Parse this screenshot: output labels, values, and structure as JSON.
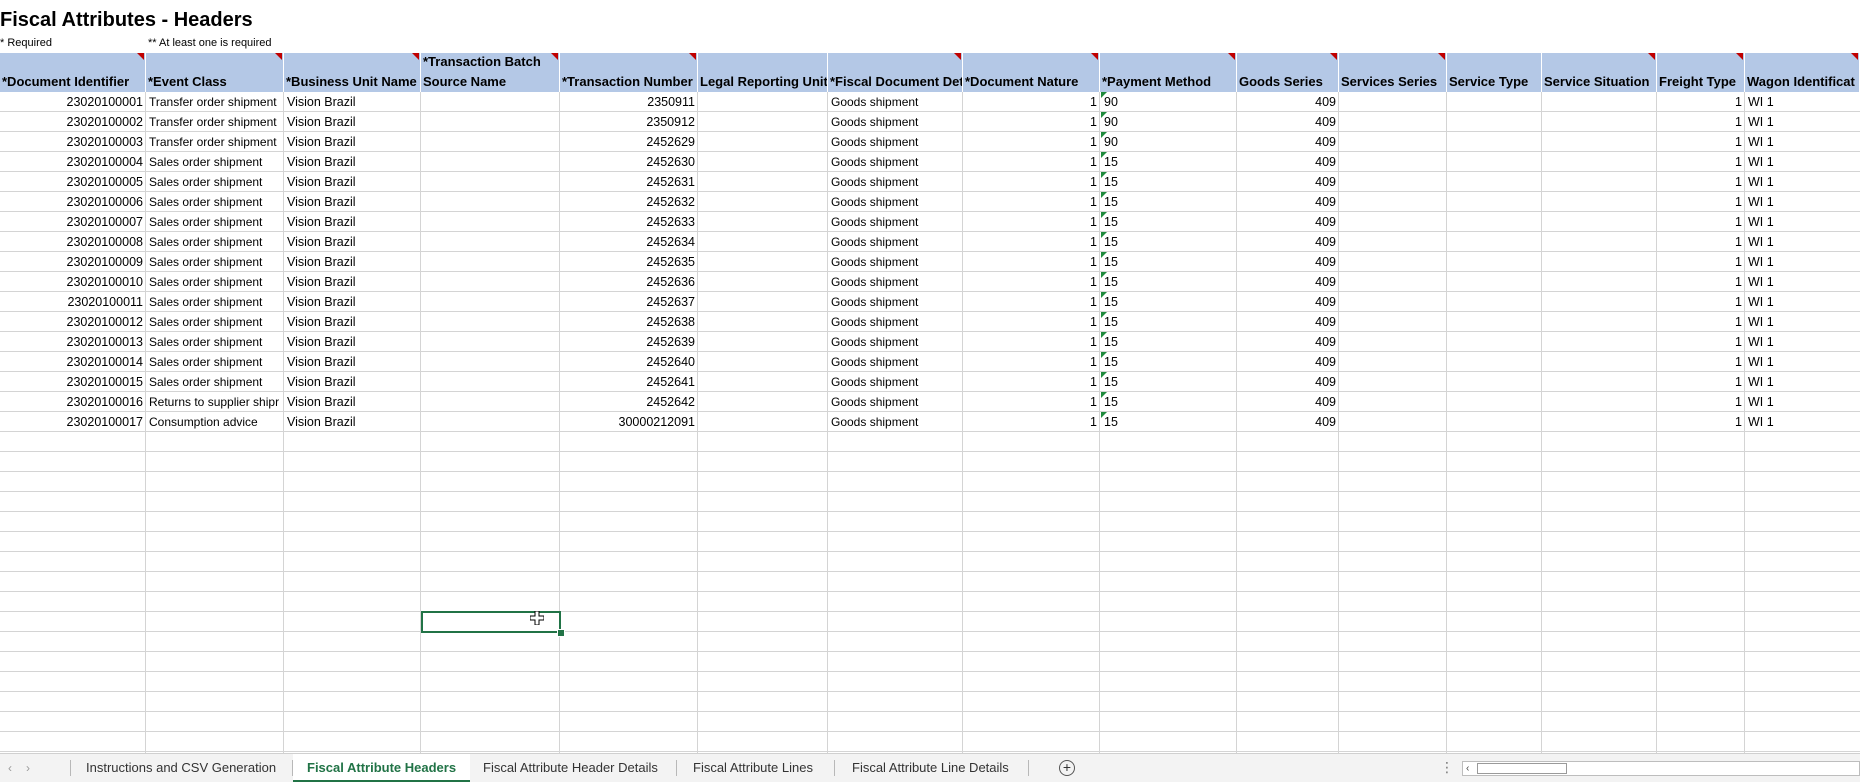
{
  "title": "Fiscal Attributes - Headers",
  "notes": {
    "required": "* Required",
    "at_least_one": "** At least one is required"
  },
  "columns": [
    "*Document Identifier",
    "*Event Class",
    "*Business Unit Name",
    "*Transaction Batch\nSource Name",
    "*Transaction Number",
    "Legal Reporting Unit",
    "*Fiscal Document Det",
    "*Document Nature",
    "*Payment Method",
    "Goods Series",
    "Services Series",
    "Service Type",
    "Service Situation",
    "Freight Type",
    "Wagon Identificat"
  ],
  "rows": [
    [
      "23020100001",
      "Transfer order shipment",
      "Vision Brazil",
      "",
      "2350911",
      "",
      "Goods shipment",
      "1",
      "90",
      "409",
      "",
      "",
      "",
      "1",
      "WI 1"
    ],
    [
      "23020100002",
      "Transfer order shipment",
      "Vision Brazil",
      "",
      "2350912",
      "",
      "Goods shipment",
      "1",
      "90",
      "409",
      "",
      "",
      "",
      "1",
      "WI 1"
    ],
    [
      "23020100003",
      "Transfer order shipment",
      "Vision Brazil",
      "",
      "2452629",
      "",
      "Goods shipment",
      "1",
      "90",
      "409",
      "",
      "",
      "",
      "1",
      "WI 1"
    ],
    [
      "23020100004",
      "Sales order shipment",
      "Vision Brazil",
      "",
      "2452630",
      "",
      "Goods shipment",
      "1",
      "15",
      "409",
      "",
      "",
      "",
      "1",
      "WI 1"
    ],
    [
      "23020100005",
      "Sales order shipment",
      "Vision Brazil",
      "",
      "2452631",
      "",
      "Goods shipment",
      "1",
      "15",
      "409",
      "",
      "",
      "",
      "1",
      "WI 1"
    ],
    [
      "23020100006",
      "Sales order shipment",
      "Vision Brazil",
      "",
      "2452632",
      "",
      "Goods shipment",
      "1",
      "15",
      "409",
      "",
      "",
      "",
      "1",
      "WI 1"
    ],
    [
      "23020100007",
      "Sales order shipment",
      "Vision Brazil",
      "",
      "2452633",
      "",
      "Goods shipment",
      "1",
      "15",
      "409",
      "",
      "",
      "",
      "1",
      "WI 1"
    ],
    [
      "23020100008",
      "Sales order shipment",
      "Vision Brazil",
      "",
      "2452634",
      "",
      "Goods shipment",
      "1",
      "15",
      "409",
      "",
      "",
      "",
      "1",
      "WI 1"
    ],
    [
      "23020100009",
      "Sales order shipment",
      "Vision Brazil",
      "",
      "2452635",
      "",
      "Goods shipment",
      "1",
      "15",
      "409",
      "",
      "",
      "",
      "1",
      "WI 1"
    ],
    [
      "23020100010",
      "Sales order shipment",
      "Vision Brazil",
      "",
      "2452636",
      "",
      "Goods shipment",
      "1",
      "15",
      "409",
      "",
      "",
      "",
      "1",
      "WI 1"
    ],
    [
      "23020100011",
      "Sales order shipment",
      "Vision Brazil",
      "",
      "2452637",
      "",
      "Goods shipment",
      "1",
      "15",
      "409",
      "",
      "",
      "",
      "1",
      "WI 1"
    ],
    [
      "23020100012",
      "Sales order shipment",
      "Vision Brazil",
      "",
      "2452638",
      "",
      "Goods shipment",
      "1",
      "15",
      "409",
      "",
      "",
      "",
      "1",
      "WI 1"
    ],
    [
      "23020100013",
      "Sales order shipment",
      "Vision Brazil",
      "",
      "2452639",
      "",
      "Goods shipment",
      "1",
      "15",
      "409",
      "",
      "",
      "",
      "1",
      "WI 1"
    ],
    [
      "23020100014",
      "Sales order shipment",
      "Vision Brazil",
      "",
      "2452640",
      "",
      "Goods shipment",
      "1",
      "15",
      "409",
      "",
      "",
      "",
      "1",
      "WI 1"
    ],
    [
      "23020100015",
      "Sales order shipment",
      "Vision Brazil",
      "",
      "2452641",
      "",
      "Goods shipment",
      "1",
      "15",
      "409",
      "",
      "",
      "",
      "1",
      "WI 1"
    ],
    [
      "23020100016",
      "Returns to supplier shipr",
      "Vision Brazil",
      "",
      "2452642",
      "",
      "Goods shipment",
      "1",
      "15",
      "409",
      "",
      "",
      "",
      "1",
      "WI 1"
    ],
    [
      "23020100017",
      "Consumption advice",
      "Vision Brazil",
      "",
      "30000212091",
      "",
      "Goods shipment",
      "1",
      "15",
      "409",
      "",
      "",
      "",
      "1",
      "WI 1"
    ]
  ],
  "tabs": [
    {
      "label": "Instructions and CSV Generation",
      "active": false
    },
    {
      "label": "Fiscal Attribute Headers",
      "active": true
    },
    {
      "label": "Fiscal Attribute Header Details",
      "active": false
    },
    {
      "label": "Fiscal Attribute Lines",
      "active": false
    },
    {
      "label": "Fiscal Attribute Line Details",
      "active": false
    }
  ],
  "tabbar": {
    "add_sheet": "+",
    "menu": "⋮",
    "prev_glyph": "‹",
    "next_glyph": "›"
  },
  "icons": {
    "cursor": "crosshair-plus-icon",
    "add_sheet": "plus-circle-icon",
    "comment_marker": "red-triangle-icon",
    "number_as_text_marker": "green-triangle-icon"
  },
  "colors": {
    "header_fill": "#b4c8e6",
    "active_tab": "#217346",
    "gridline": "#d4d4d4",
    "comment_marker": "#c00000",
    "warning_marker": "#1e8a3c"
  }
}
